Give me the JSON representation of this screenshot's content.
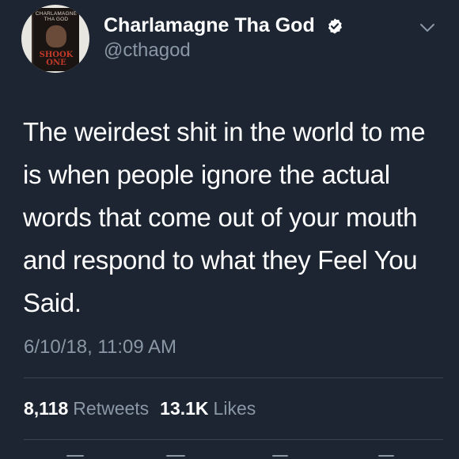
{
  "tweet": {
    "author": {
      "display_name": "Charlamagne Tha God",
      "handle": "@cthagod",
      "verified": true,
      "avatar": {
        "book_author": "CHARLAMAGNE THA GOD",
        "book_title": "SHOOK ONE"
      }
    },
    "text": "The weirdest shit in the world to me is when people ignore the actual words that come out of your mouth and respond to what they Feel You Said.",
    "timestamp": "6/10/18, 11:09 AM",
    "stats": {
      "retweets_count": "8,118",
      "retweets_label": "Retweets",
      "likes_count": "13.1K",
      "likes_label": "Likes"
    },
    "icons": {
      "verified": "verified-badge-icon",
      "menu": "chevron-down-icon"
    },
    "colors": {
      "background": "#1c2531",
      "text_primary": "#ffffff",
      "text_secondary": "#8a97a5",
      "divider": "#38444f"
    }
  }
}
